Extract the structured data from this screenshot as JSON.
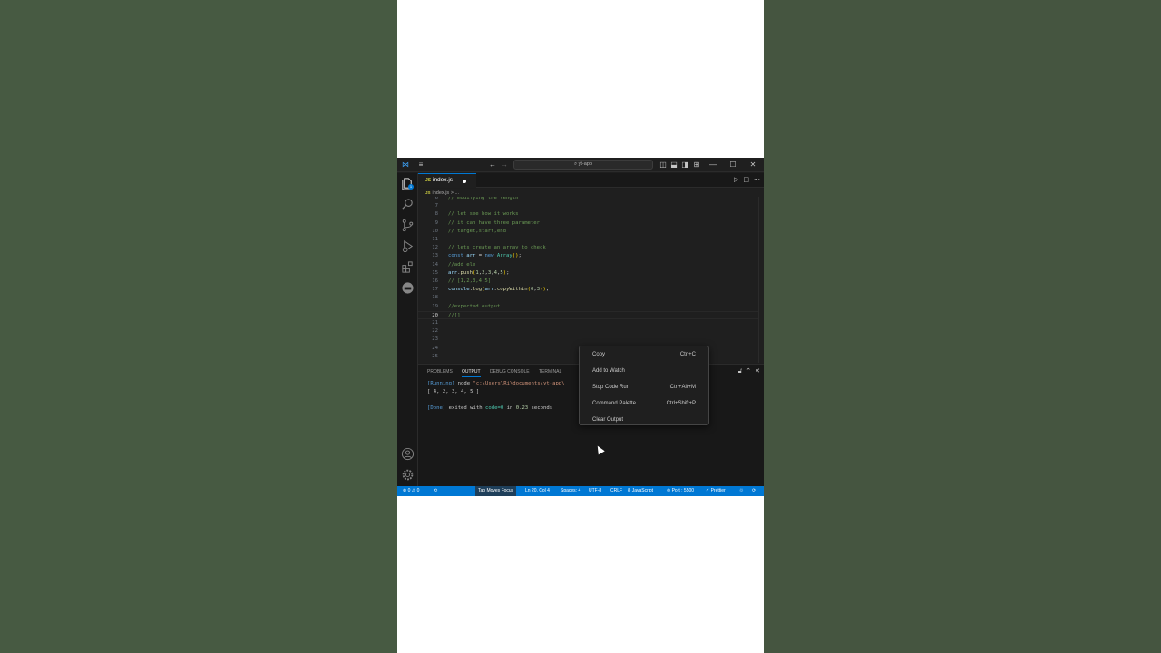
{
  "titlebar": {
    "search_text": "yt-app",
    "icons": [
      "vscode-logo-icon",
      "menu-icon",
      "back-icon",
      "forward-icon",
      "toggle-sidebar-icon",
      "toggle-panel-icon",
      "toggle-secondary-icon",
      "customize-layout-icon",
      "minimize-icon",
      "maximize-icon",
      "close-icon"
    ]
  },
  "activity": {
    "explorer_badge": "1",
    "items": [
      "explorer-icon",
      "search-icon",
      "source-control-icon",
      "run-debug-icon",
      "extensions-icon",
      "docker-icon",
      "account-icon",
      "settings-gear-icon"
    ]
  },
  "tab": {
    "file_icon": "JS",
    "name": "index.js"
  },
  "breadcrumb": {
    "file_icon": "JS",
    "file": "index.js",
    "rest": "> ..."
  },
  "editor": {
    "lines": [
      {
        "n": "6",
        "tokens": [
          [
            "c-cm",
            "// modifying the length"
          ]
        ]
      },
      {
        "n": "7",
        "tokens": []
      },
      {
        "n": "8",
        "tokens": [
          [
            "c-cm",
            "// let see how it works"
          ]
        ]
      },
      {
        "n": "9",
        "tokens": [
          [
            "c-cm",
            "// it can have three parameter"
          ]
        ]
      },
      {
        "n": "10",
        "tokens": [
          [
            "c-cm",
            "// target,start,end"
          ]
        ]
      },
      {
        "n": "11",
        "tokens": []
      },
      {
        "n": "12",
        "tokens": [
          [
            "c-cm",
            "// lets create an array to check"
          ]
        ]
      },
      {
        "n": "13",
        "tokens": [
          [
            "c-kw",
            "const "
          ],
          [
            "c-var",
            "arr"
          ],
          [
            "c-pl",
            " = "
          ],
          [
            "c-kw",
            "new "
          ],
          [
            "c-cls",
            "Array"
          ],
          [
            "c-br",
            "()"
          ],
          [
            "c-pl",
            ";"
          ]
        ]
      },
      {
        "n": "14",
        "tokens": [
          [
            "c-cm",
            "//add ele"
          ]
        ]
      },
      {
        "n": "15",
        "tokens": [
          [
            "c-var",
            "arr"
          ],
          [
            "c-pl",
            "."
          ],
          [
            "c-fn",
            "push"
          ],
          [
            "c-br",
            "("
          ],
          [
            "c-num",
            "1"
          ],
          [
            "c-pl",
            ","
          ],
          [
            "c-num",
            "2"
          ],
          [
            "c-pl",
            ","
          ],
          [
            "c-num",
            "3"
          ],
          [
            "c-pl",
            ","
          ],
          [
            "c-num",
            "4"
          ],
          [
            "c-pl",
            ","
          ],
          [
            "c-num",
            "5"
          ],
          [
            "c-br",
            ")"
          ],
          [
            "c-pl",
            ";"
          ]
        ]
      },
      {
        "n": "16",
        "tokens": [
          [
            "c-cm",
            "// [1,2,3,4,5]"
          ]
        ]
      },
      {
        "n": "17",
        "tokens": [
          [
            "c-var",
            "console"
          ],
          [
            "c-pl",
            "."
          ],
          [
            "c-fn",
            "log"
          ],
          [
            "c-br",
            "("
          ],
          [
            "c-var",
            "arr"
          ],
          [
            "c-pl",
            "."
          ],
          [
            "c-fn",
            "copyWithin"
          ],
          [
            "c-br",
            "("
          ],
          [
            "c-num",
            "0"
          ],
          [
            "c-pl",
            ","
          ],
          [
            "c-num",
            "3"
          ],
          [
            "c-br",
            "))"
          ],
          [
            "c-pl",
            ";"
          ]
        ]
      },
      {
        "n": "18",
        "tokens": []
      },
      {
        "n": "19",
        "tokens": [
          [
            "c-cm",
            "//expected output"
          ]
        ]
      },
      {
        "n": "20",
        "tokens": [
          [
            "c-cm",
            "//[]"
          ]
        ],
        "current": true
      },
      {
        "n": "21",
        "tokens": []
      },
      {
        "n": "22",
        "tokens": []
      },
      {
        "n": "23",
        "tokens": []
      },
      {
        "n": "24",
        "tokens": []
      },
      {
        "n": "25",
        "tokens": []
      }
    ]
  },
  "panel": {
    "tabs": [
      "PROBLEMS",
      "OUTPUT",
      "DEBUG CONSOLE",
      "TERMINAL"
    ],
    "active_tab": "OUTPUT",
    "output": {
      "running_tag": "[Running]",
      "running_cmd": " node ",
      "running_path": "\"c:\\Users\\Ri\\documents\\yt-app\\",
      "result": "[ 4, 2, 3, 4, 5 ]",
      "done_tag": "[Done]",
      "done_text1": " exited with ",
      "done_code": "code=0",
      "done_text2": " in ",
      "done_time": "0.23",
      "done_text3": " seconds"
    }
  },
  "context_menu": {
    "items": [
      {
        "label": "Copy",
        "shortcut": "Ctrl+C"
      },
      {
        "label": "Add to Watch",
        "shortcut": ""
      },
      {
        "label": "Stop Code Run",
        "shortcut": "Ctrl+Alt+M"
      },
      {
        "label": "Command Palette...",
        "shortcut": "Ctrl+Shift+P"
      },
      {
        "label": "Clear Output",
        "shortcut": ""
      }
    ]
  },
  "status": {
    "errors": "⊗ 0 ⚠ 0",
    "focus": "Tab Moves Focus",
    "position": "Ln 20, Col 4",
    "spaces": "Spaces: 4",
    "encoding": "UTF-8",
    "eol": "CRLF",
    "language": "{} JavaScript",
    "port": "⊘ Port : 5500",
    "prettier": "✓ Prettier"
  },
  "colors": {
    "accent": "#0078d4",
    "status_bg": "#0078d4",
    "editor_bg": "#1f1f1f"
  }
}
